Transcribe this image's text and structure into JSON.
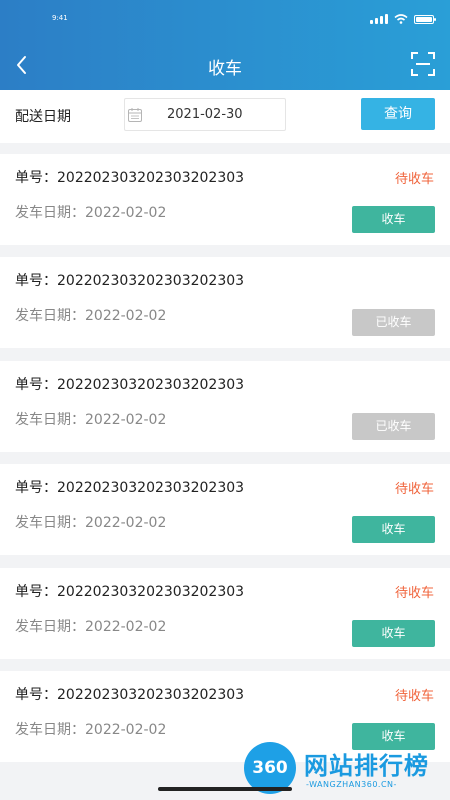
{
  "status_bar": {
    "time": "9:41"
  },
  "header": {
    "title": "收车"
  },
  "filter": {
    "label": "配送日期",
    "date": "2021-02-30",
    "query_label": "查询"
  },
  "orders": [
    {
      "order_no": "单号：20220230320230320230​3",
      "depart": "发车日期：2022-02-02",
      "status": "待收车",
      "action": "收车",
      "state": "pending"
    },
    {
      "order_no": "单号：20220230320230320230​3",
      "depart": "发车日期：2022-02-02",
      "status": "",
      "action": "已收车",
      "state": "done"
    },
    {
      "order_no": "单号：20220230320230320230​3",
      "depart": "发车日期：2022-02-02",
      "status": "",
      "action": "已收车",
      "state": "done"
    },
    {
      "order_no": "单号：20220230320230320230​3",
      "depart": "发车日期：2022-02-02",
      "status": "待收车",
      "action": "收车",
      "state": "pending"
    },
    {
      "order_no": "单号：20220230320230320230​3",
      "depart": "发车日期：2022-02-02",
      "status": "待收车",
      "action": "收车",
      "state": "pending"
    },
    {
      "order_no": "单号：20220230320230320230​3",
      "depart": "发车日期：2022-02-02",
      "status": "待收车",
      "action": "收车",
      "state": "pending"
    }
  ],
  "watermark": {
    "logo_text": "360",
    "title": "网站排行榜",
    "subtitle": "-WANGZHAN360.CN-"
  },
  "colors": {
    "header_start": "#2c7ec6",
    "header_end": "#2a9fd7",
    "query": "#35b3e4",
    "action": "#3fb59e",
    "disabled": "#c8c8c8",
    "pending": "#f0643c"
  },
  "icons": {
    "back": "chevron-left-icon",
    "scan": "scan-icon",
    "calendar": "calendar-icon"
  }
}
